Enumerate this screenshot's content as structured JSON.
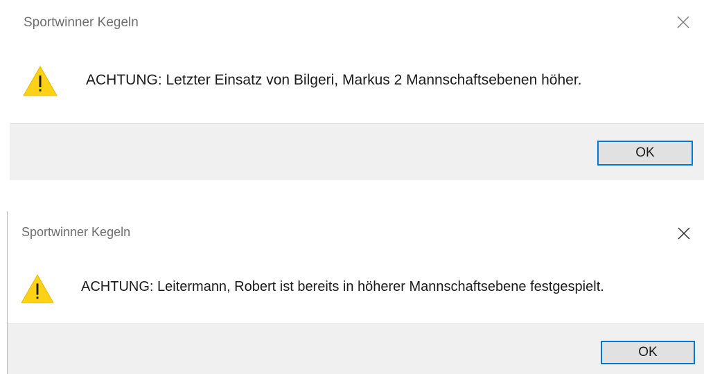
{
  "dialogs": [
    {
      "title": "Sportwinner Kegeln",
      "message": "ACHTUNG: Letzter Einsatz von Bilgeri, Markus 2 Mannschaftsebenen höher.",
      "ok_label": "OK",
      "icon": "warning-icon",
      "close_icon": "close-icon"
    },
    {
      "title": "Sportwinner Kegeln",
      "message": "ACHTUNG: Leitermann, Robert ist bereits in höherer Mannschaftsebene festgespielt.",
      "ok_label": "OK",
      "icon": "warning-icon",
      "close_icon": "close-icon"
    }
  ],
  "colors": {
    "warning_fill": "#fcd116",
    "warning_mark": "#1b1b1b",
    "button_border": "#0078d7",
    "footer_bg": "#f0f0f0",
    "title_text": "#6e6e6e"
  }
}
